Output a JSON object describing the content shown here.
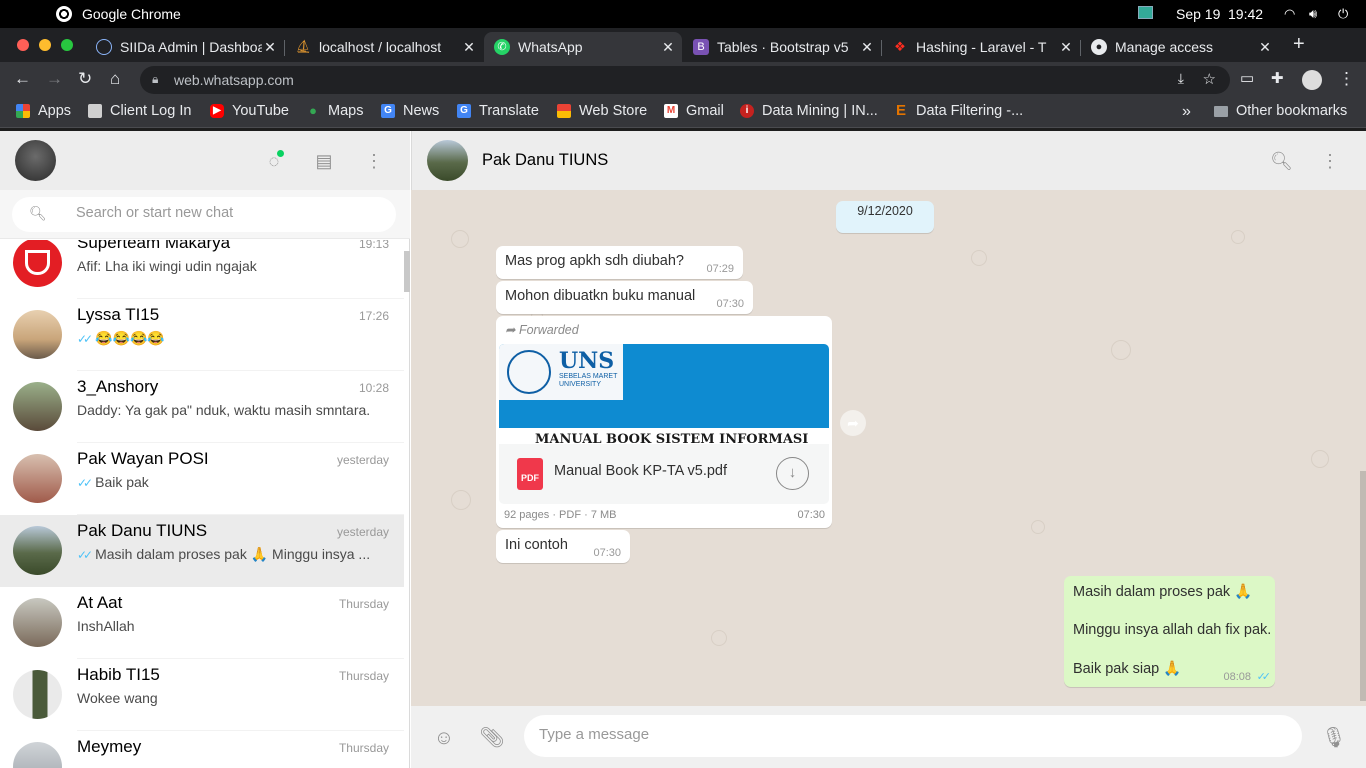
{
  "os": {
    "app_name": "Google Chrome",
    "date": "Sep 19",
    "time": "19:42"
  },
  "tabs": [
    {
      "title": "SIIDa Admin | Dashboard",
      "favicon": "globe-icon",
      "color": "#8ab4f8"
    },
    {
      "title": "localhost / localhost",
      "favicon": "phpmyadmin-icon",
      "color": "#f0a030"
    },
    {
      "title": "WhatsApp",
      "favicon": "whatsapp-icon",
      "color": "#25d366",
      "active": true
    },
    {
      "title": "Tables · Bootstrap v5",
      "favicon": "bootstrap-icon",
      "color": "#7952b3"
    },
    {
      "title": "Hashing - Laravel - T",
      "favicon": "laravel-icon",
      "color": "#ff2d20"
    },
    {
      "title": "Manage access",
      "favicon": "github-icon",
      "color": "#e8eaed"
    }
  ],
  "address_bar": {
    "url": "web.whatsapp.com"
  },
  "bookmarks": [
    {
      "label": "Apps",
      "icon": "apps-grid-icon",
      "color": "#ea4335"
    },
    {
      "label": "Client Log In",
      "icon": "client-login-icon",
      "color": "#cfcfcf"
    },
    {
      "label": "YouTube",
      "icon": "youtube-icon",
      "color": "#ff0000"
    },
    {
      "label": "Maps",
      "icon": "maps-icon",
      "color": "#34a853"
    },
    {
      "label": "News",
      "icon": "news-icon",
      "color": "#4285f4"
    },
    {
      "label": "Translate",
      "icon": "translate-icon",
      "color": "#4285f4"
    },
    {
      "label": "Web Store",
      "icon": "web-store-icon",
      "color": "#ea4335"
    },
    {
      "label": "Gmail",
      "icon": "gmail-icon",
      "color": "#ea4335"
    },
    {
      "label": "Data Mining | IN...",
      "icon": "data-mining-icon",
      "color": "#c5221f"
    },
    {
      "label": "Data Filtering -...",
      "icon": "data-filtering-icon",
      "color": "#e37400"
    }
  ],
  "other_bookmarks": "Other bookmarks",
  "search": {
    "placeholder": "Search or start new chat"
  },
  "chats": [
    {
      "name": "Superteam Makarya",
      "time": "19:13",
      "message": "Afif: Lha iki wingi udin ngajak",
      "ticks": false,
      "avatar_color": "#e31e24"
    },
    {
      "name": "Lyssa TI15",
      "time": "17:26",
      "message": "😂😂😂😂",
      "ticks": true,
      "avatar_color": "#c9a57a"
    },
    {
      "name": "3_Anshory",
      "time": "10:28",
      "message": "Daddy: Ya gak pa\" nduk, waktu masih smntara.",
      "ticks": false,
      "avatar_color": "#5a4a3a"
    },
    {
      "name": "Pak Wayan POSI",
      "time": "yesterday",
      "message": "Baik pak",
      "ticks": true,
      "avatar_color": "#a05a4a"
    },
    {
      "name": "Pak Danu TIUNS",
      "time": "yesterday",
      "message": "Masih dalam proses pak 🙏  Minggu insya ...",
      "ticks": true,
      "avatar_color": "#5a6a4a",
      "selected": true
    },
    {
      "name": "At Aat",
      "time": "Thursday",
      "message": "InshAllah",
      "ticks": false,
      "avatar_color": "#7a6a5a"
    },
    {
      "name": "Habib TI15",
      "time": "Thursday",
      "message": "Wokee wang",
      "ticks": false,
      "avatar_color": "#4a5a3a"
    },
    {
      "name": "Meymey",
      "time": "Thursday",
      "message": "",
      "ticks": false,
      "avatar_color": "#9aa0a6"
    }
  ],
  "conversation": {
    "contact_name": "Pak Danu TIUNS",
    "date_label": "9/12/2020",
    "messages": [
      {
        "text": "Mas prog apkh sdh diubah?",
        "time": "07:29"
      },
      {
        "text": "Mohon dibuatkn buku manual",
        "time": "07:30"
      },
      {
        "text": "Ini contoh",
        "time": "07:30"
      }
    ],
    "document": {
      "forwarded_label": "Forwarded",
      "thumb_logo": "UNS",
      "thumb_logo_sub": "SEBELAS MARET UNIVERSITY",
      "thumb_title": "MANUAL BOOK SISTEM INFORMASI",
      "file_badge": "PDF",
      "filename": "Manual Book KP-TA v5.pdf",
      "meta": "92 pages · PDF · 7 MB",
      "time": "07:30"
    },
    "outgoing": {
      "line1": "Masih dalam proses pak 🙏",
      "line2": "Minggu insya allah dah fix pak.",
      "line3": "Baik pak siap 🙏",
      "time": "08:08"
    }
  },
  "composer": {
    "placeholder": "Type a message"
  }
}
